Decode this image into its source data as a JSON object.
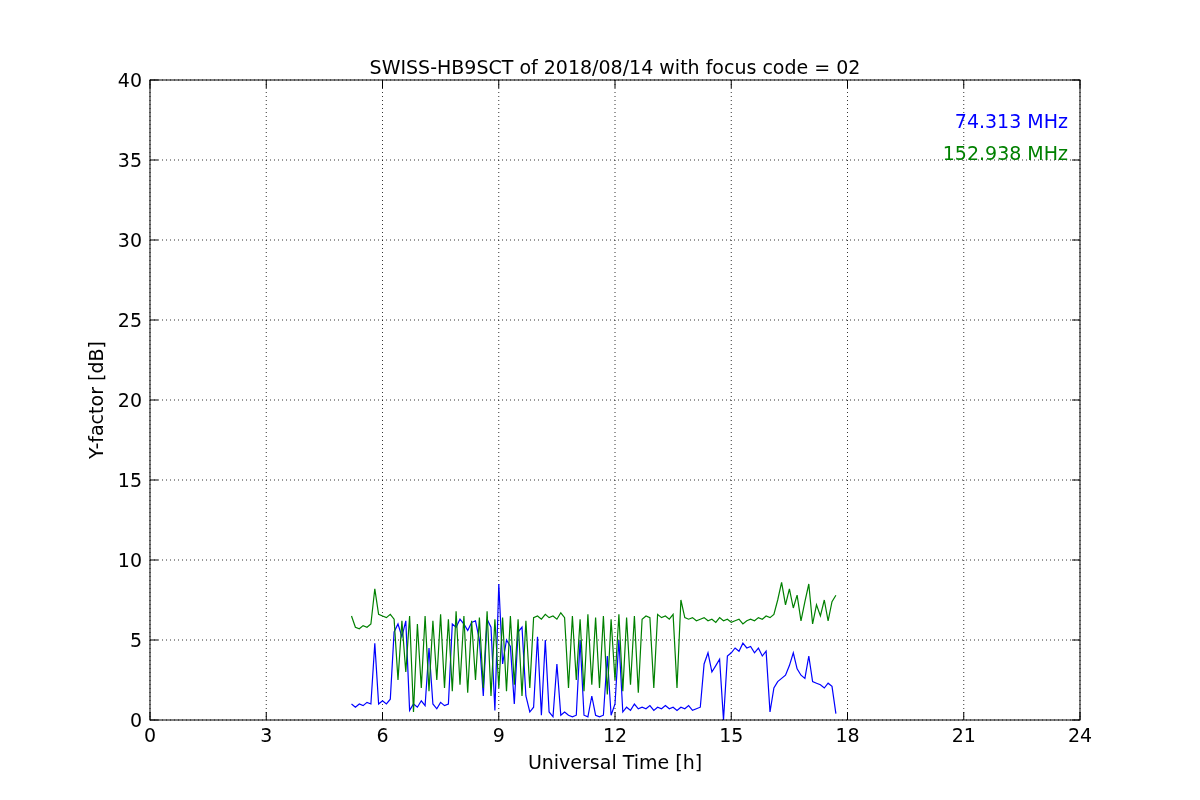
{
  "chart_data": {
    "type": "line",
    "title": "SWISS-HB9SCT of 2018/08/14 with focus code = 02",
    "xlabel": "Universal Time [h]",
    "ylabel": "Y-factor [dB]",
    "x": [
      5.2,
      5.3,
      5.4,
      5.5,
      5.6,
      5.7,
      5.8,
      5.9,
      6.0,
      6.1,
      6.2,
      6.3,
      6.4,
      6.5,
      6.6,
      6.7,
      6.8,
      6.9,
      7.0,
      7.1,
      7.2,
      7.3,
      7.4,
      7.5,
      7.6,
      7.7,
      7.8,
      7.9,
      8.0,
      8.1,
      8.2,
      8.3,
      8.4,
      8.5,
      8.6,
      8.7,
      8.8,
      8.9,
      9.0,
      9.1,
      9.2,
      9.3,
      9.4,
      9.5,
      9.6,
      9.7,
      9.8,
      9.9,
      10.0,
      10.1,
      10.2,
      10.3,
      10.4,
      10.5,
      10.6,
      10.7,
      10.8,
      10.9,
      11.0,
      11.1,
      11.2,
      11.3,
      11.4,
      11.5,
      11.6,
      11.7,
      11.8,
      11.9,
      12.0,
      12.1,
      12.2,
      12.3,
      12.4,
      12.5,
      12.6,
      12.7,
      12.8,
      12.9,
      13.0,
      13.1,
      13.2,
      13.3,
      13.4,
      13.5,
      13.6,
      13.7,
      13.8,
      13.9,
      14.0,
      14.1,
      14.2,
      14.3,
      14.4,
      14.5,
      14.6,
      14.7,
      14.8,
      14.9,
      15.0,
      15.1,
      15.2,
      15.3,
      15.4,
      15.5,
      15.6,
      15.7,
      15.8,
      15.9,
      16.0,
      16.1,
      16.2,
      16.3,
      16.4,
      16.5,
      16.6,
      16.7,
      16.8,
      16.9,
      17.0,
      17.1,
      17.2,
      17.3,
      17.4,
      17.5,
      17.6,
      17.7
    ],
    "series": [
      {
        "name": "74.313 MHz",
        "color": "#0000ff",
        "values": [
          1.0,
          0.8,
          1.0,
          0.9,
          1.1,
          1.0,
          4.8,
          1.0,
          1.2,
          1.0,
          1.3,
          5.5,
          6.0,
          5.2,
          6.2,
          0.6,
          1.0,
          0.8,
          1.2,
          0.9,
          4.5,
          1.0,
          0.7,
          1.1,
          0.9,
          1.0,
          6.0,
          5.8,
          6.3,
          6.0,
          5.6,
          6.1,
          6.2,
          5.0,
          1.5,
          6.3,
          5.8,
          0.6,
          8.5,
          3.5,
          5.0,
          4.6,
          1.0,
          5.5,
          5.8,
          1.5,
          0.5,
          0.8,
          5.2,
          0.3,
          5.0,
          0.5,
          0.2,
          3.5,
          0.3,
          0.5,
          0.3,
          0.2,
          0.3,
          5.0,
          0.3,
          0.2,
          1.5,
          0.3,
          0.2,
          0.3,
          4.0,
          0.3,
          1.0,
          5.0,
          0.5,
          0.8,
          0.6,
          1.0,
          0.7,
          0.8,
          0.7,
          0.9,
          0.6,
          0.8,
          0.7,
          0.9,
          0.7,
          0.8,
          0.6,
          0.8,
          0.7,
          0.9,
          0.6,
          0.7,
          0.8,
          3.5,
          4.2,
          3.0,
          3.4,
          3.8,
          0.0,
          4.0,
          4.2,
          4.5,
          4.3,
          4.8,
          4.5,
          4.6,
          4.2,
          4.5,
          4.0,
          4.3,
          0.5,
          2.0,
          2.4,
          2.6,
          2.8,
          3.4,
          4.2,
          3.2,
          2.8,
          2.6,
          4.0,
          2.4,
          2.3,
          2.2,
          2.0,
          2.3,
          2.1,
          0.4
        ]
      },
      {
        "name": "152.938 MHz",
        "color": "#008000",
        "values": [
          6.5,
          5.8,
          5.7,
          5.9,
          5.8,
          6.0,
          8.2,
          6.6,
          6.5,
          6.4,
          6.6,
          6.3,
          2.5,
          6.2,
          3.0,
          6.5,
          0.5,
          6.0,
          2.0,
          6.5,
          1.8,
          6.2,
          2.5,
          6.6,
          2.0,
          6.3,
          1.8,
          6.8,
          2.2,
          6.5,
          1.7,
          6.2,
          2.5,
          6.4,
          2.0,
          6.8,
          1.5,
          6.3,
          2.0,
          6.4,
          1.8,
          6.5,
          2.2,
          6.3,
          1.5,
          6.2,
          2.0,
          6.4,
          6.5,
          6.3,
          6.6,
          6.4,
          6.5,
          6.3,
          6.7,
          6.4,
          2.0,
          6.5,
          2.5,
          6.3,
          1.8,
          6.6,
          2.2,
          6.4,
          2.0,
          6.5,
          1.6,
          6.3,
          2.5,
          6.6,
          1.8,
          6.4,
          2.2,
          6.5,
          1.7,
          6.3,
          6.5,
          6.4,
          2.0,
          6.6,
          6.4,
          6.5,
          6.3,
          6.6,
          2.0,
          7.5,
          6.4,
          6.3,
          6.4,
          6.2,
          6.3,
          6.4,
          6.2,
          6.3,
          6.1,
          6.4,
          6.2,
          6.3,
          6.1,
          6.2,
          6.3,
          6.0,
          6.2,
          6.3,
          6.2,
          6.4,
          6.3,
          6.5,
          6.4,
          6.6,
          7.5,
          8.6,
          7.2,
          8.2,
          7.0,
          7.8,
          6.2,
          7.4,
          8.5,
          6.0,
          7.2,
          6.5,
          7.5,
          6.2,
          7.4,
          7.8
        ]
      }
    ],
    "xlim": [
      0,
      24
    ],
    "ylim": [
      0,
      40
    ],
    "xticks": [
      0,
      3,
      6,
      9,
      12,
      15,
      18,
      21,
      24
    ],
    "yticks": [
      0,
      5,
      10,
      15,
      20,
      25,
      30,
      35,
      40
    ],
    "grid": true
  }
}
